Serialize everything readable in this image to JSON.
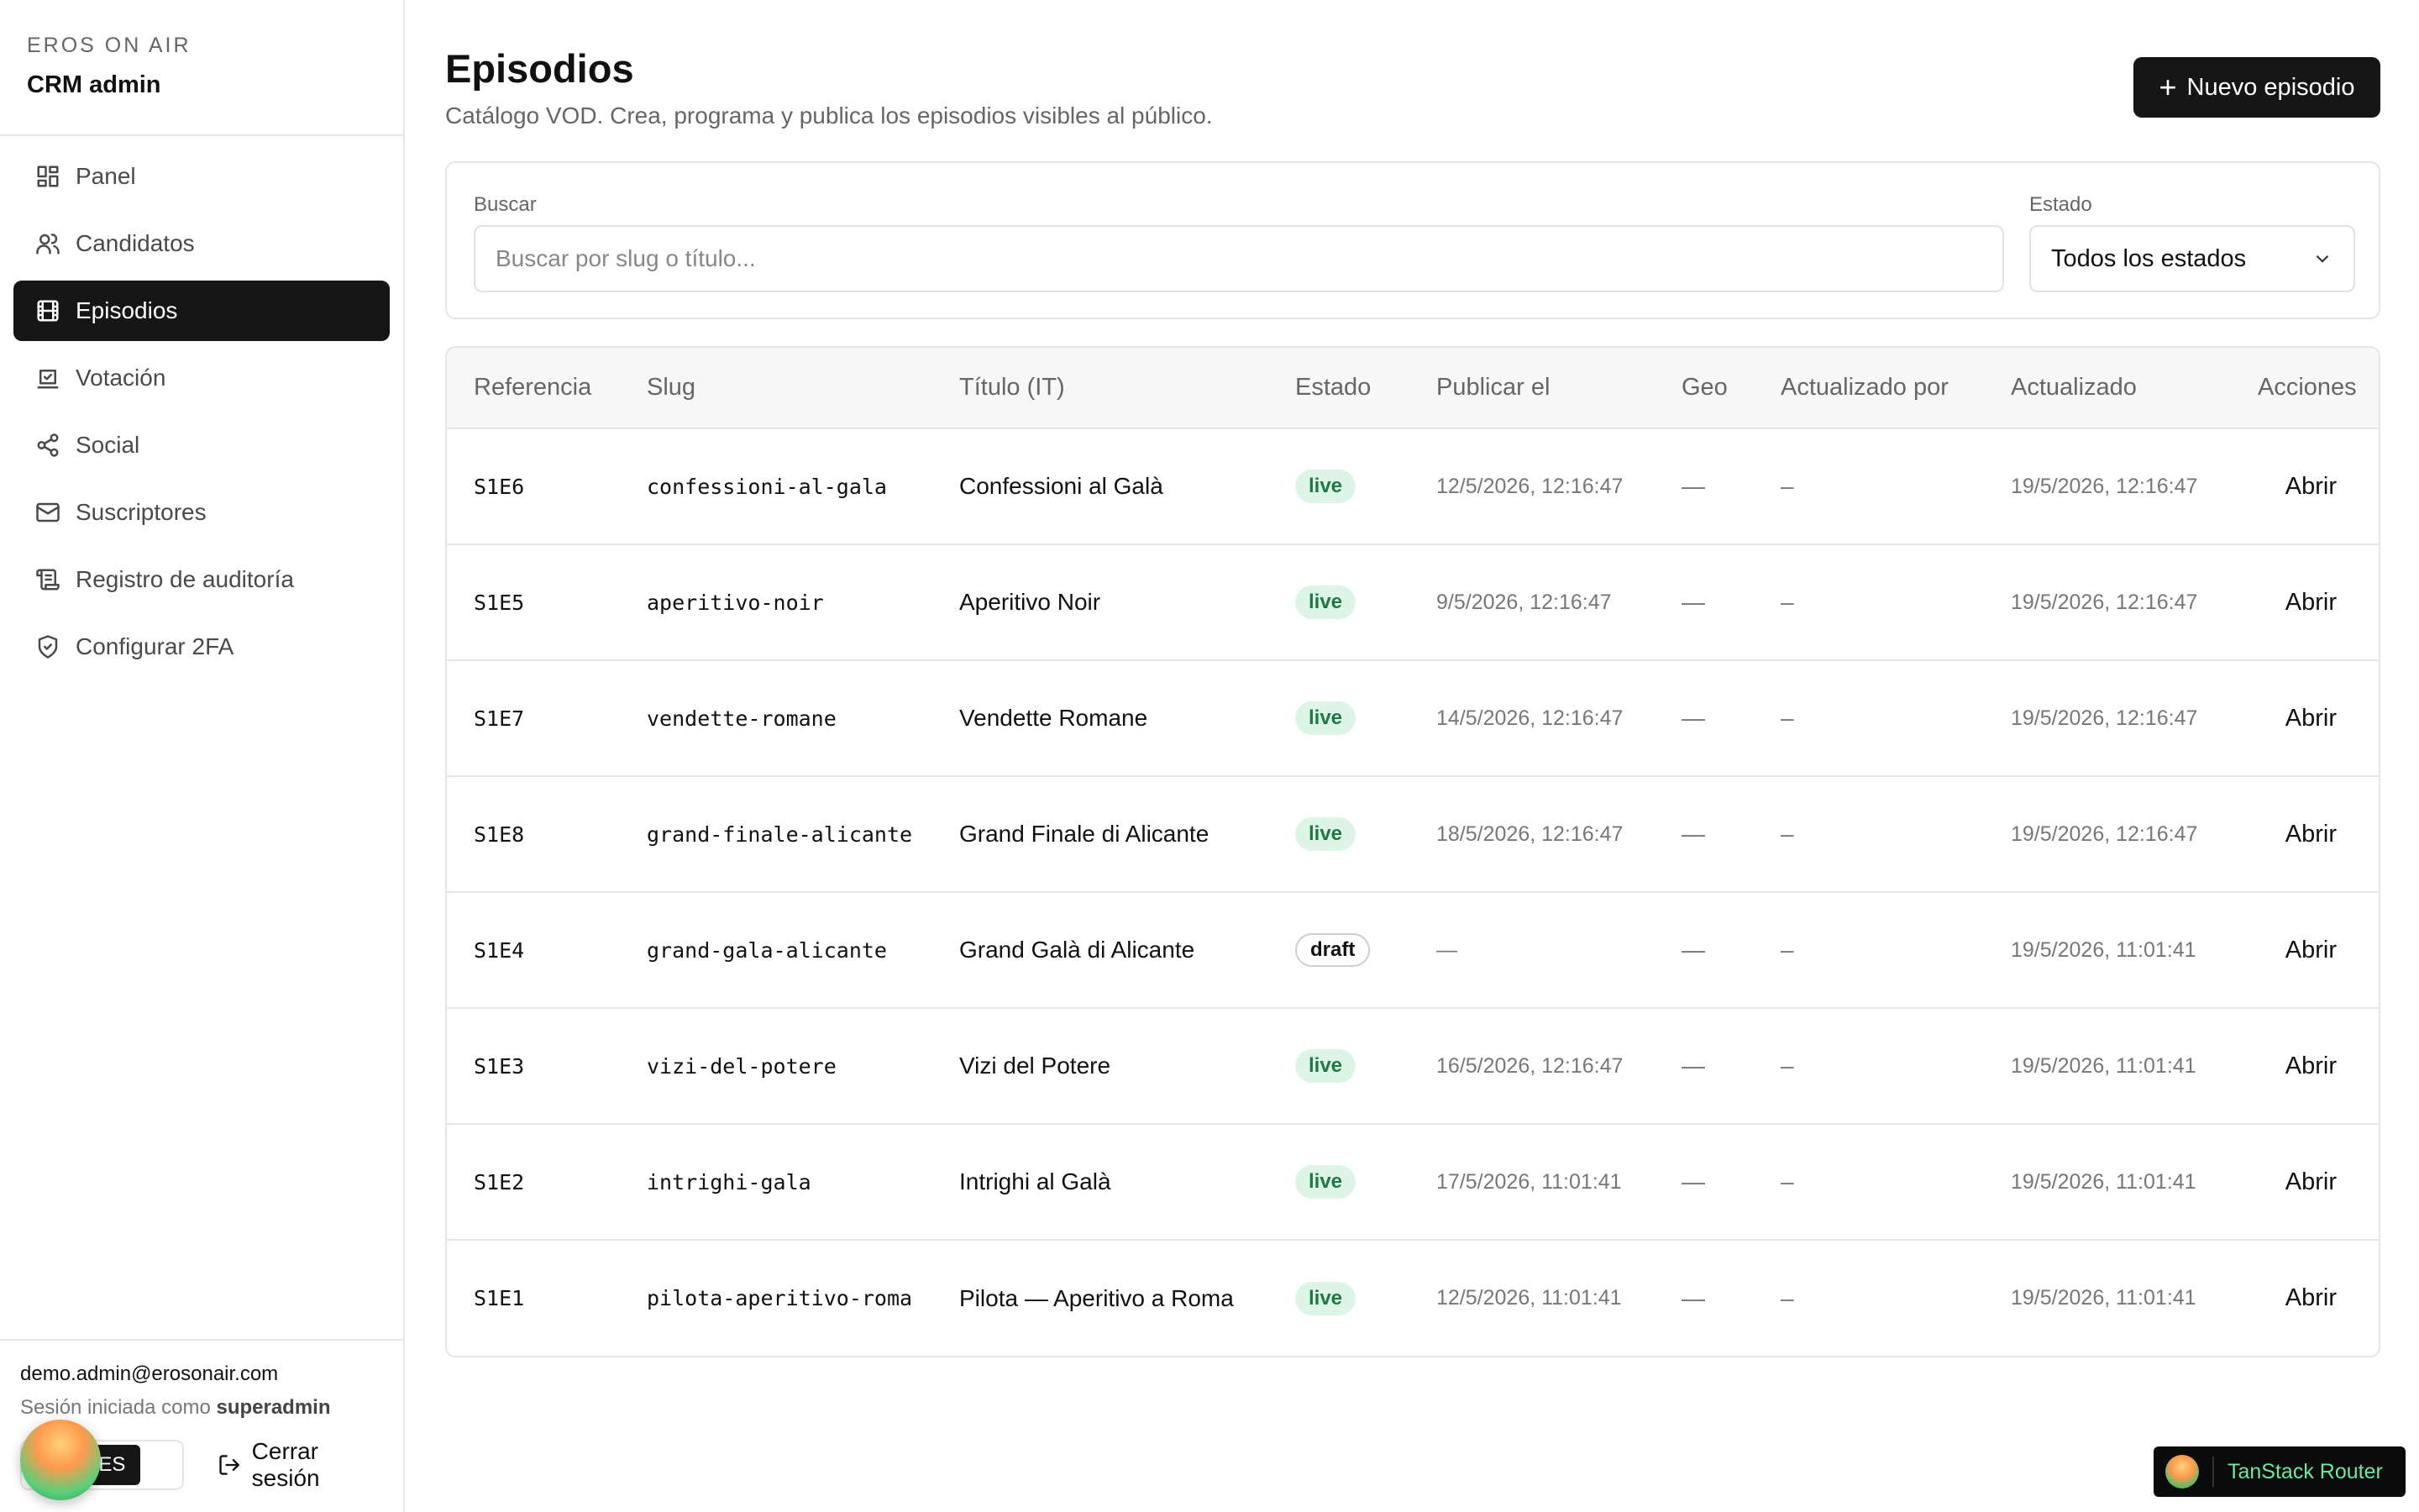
{
  "brand": {
    "name": "EROS ON AIR",
    "subtitle": "CRM admin"
  },
  "sidebar": {
    "items": [
      {
        "label": "Panel",
        "icon": "dashboard-icon",
        "active": false
      },
      {
        "label": "Candidatos",
        "icon": "users-icon",
        "active": false
      },
      {
        "label": "Episodios",
        "icon": "film-icon",
        "active": true
      },
      {
        "label": "Votación",
        "icon": "vote-icon",
        "active": false
      },
      {
        "label": "Social",
        "icon": "share-icon",
        "active": false
      },
      {
        "label": "Suscriptores",
        "icon": "mail-icon",
        "active": false
      },
      {
        "label": "Registro de auditoría",
        "icon": "scroll-icon",
        "active": false
      },
      {
        "label": "Configurar 2FA",
        "icon": "shield-icon",
        "active": false
      }
    ],
    "footer": {
      "email": "demo.admin@erosonair.com",
      "session_prefix": "Sesión iniciada como",
      "role": "superadmin",
      "lang_en": "EN",
      "lang_es": "ES",
      "logout_label": "Cerrar sesión"
    }
  },
  "header": {
    "title": "Episodios",
    "description": "Catálogo VOD. Crea, programa y publica los episodios visibles al público.",
    "new_button_label": "Nuevo episodio"
  },
  "filters": {
    "search_label": "Buscar",
    "search_placeholder": "Buscar por slug o título...",
    "search_value": "",
    "status_label": "Estado",
    "status_value": "Todos los estados"
  },
  "table": {
    "columns": [
      "Referencia",
      "Slug",
      "Título (IT)",
      "Estado",
      "Publicar el",
      "Geo",
      "Actualizado por",
      "Actualizado",
      "Acciones"
    ],
    "rows": [
      {
        "ref": "S1E6",
        "slug": "confessioni-al-gala",
        "title": "Confessioni al Galà",
        "status": "live",
        "publish": "12/5/2026, 12:16:47",
        "geo": "—",
        "updated_by": "–",
        "updated": "19/5/2026, 12:16:47",
        "action": "Abrir"
      },
      {
        "ref": "S1E5",
        "slug": "aperitivo-noir",
        "title": "Aperitivo Noir",
        "status": "live",
        "publish": "9/5/2026, 12:16:47",
        "geo": "—",
        "updated_by": "–",
        "updated": "19/5/2026, 12:16:47",
        "action": "Abrir"
      },
      {
        "ref": "S1E7",
        "slug": "vendette-romane",
        "title": "Vendette Romane",
        "status": "live",
        "publish": "14/5/2026, 12:16:47",
        "geo": "—",
        "updated_by": "–",
        "updated": "19/5/2026, 12:16:47",
        "action": "Abrir"
      },
      {
        "ref": "S1E8",
        "slug": "grand-finale-alicante",
        "title": "Grand Finale di Alicante",
        "status": "live",
        "publish": "18/5/2026, 12:16:47",
        "geo": "—",
        "updated_by": "–",
        "updated": "19/5/2026, 12:16:47",
        "action": "Abrir"
      },
      {
        "ref": "S1E4",
        "slug": "grand-gala-alicante",
        "title": "Grand Galà di Alicante",
        "status": "draft",
        "publish": "—",
        "geo": "—",
        "updated_by": "–",
        "updated": "19/5/2026, 11:01:41",
        "action": "Abrir"
      },
      {
        "ref": "S1E3",
        "slug": "vizi-del-potere",
        "title": "Vizi del Potere",
        "status": "live",
        "publish": "16/5/2026, 12:16:47",
        "geo": "—",
        "updated_by": "–",
        "updated": "19/5/2026, 11:01:41",
        "action": "Abrir"
      },
      {
        "ref": "S1E2",
        "slug": "intrighi-gala",
        "title": "Intrighi al Galà",
        "status": "live",
        "publish": "17/5/2026, 11:01:41",
        "geo": "—",
        "updated_by": "–",
        "updated": "19/5/2026, 11:01:41",
        "action": "Abrir"
      },
      {
        "ref": "S1E1",
        "slug": "pilota-aperitivo-roma",
        "title": "Pilota — Aperitivo a Roma",
        "status": "live",
        "publish": "12/5/2026, 11:01:41",
        "geo": "—",
        "updated_by": "–",
        "updated": "19/5/2026, 11:01:41",
        "action": "Abrir"
      }
    ]
  },
  "devtools": {
    "label": "TanStack Router"
  },
  "colors": {
    "accent": "#161616",
    "live_bg": "#dcf5e6",
    "live_text": "#1e7a45",
    "devtools_text": "#6ee7a0"
  }
}
